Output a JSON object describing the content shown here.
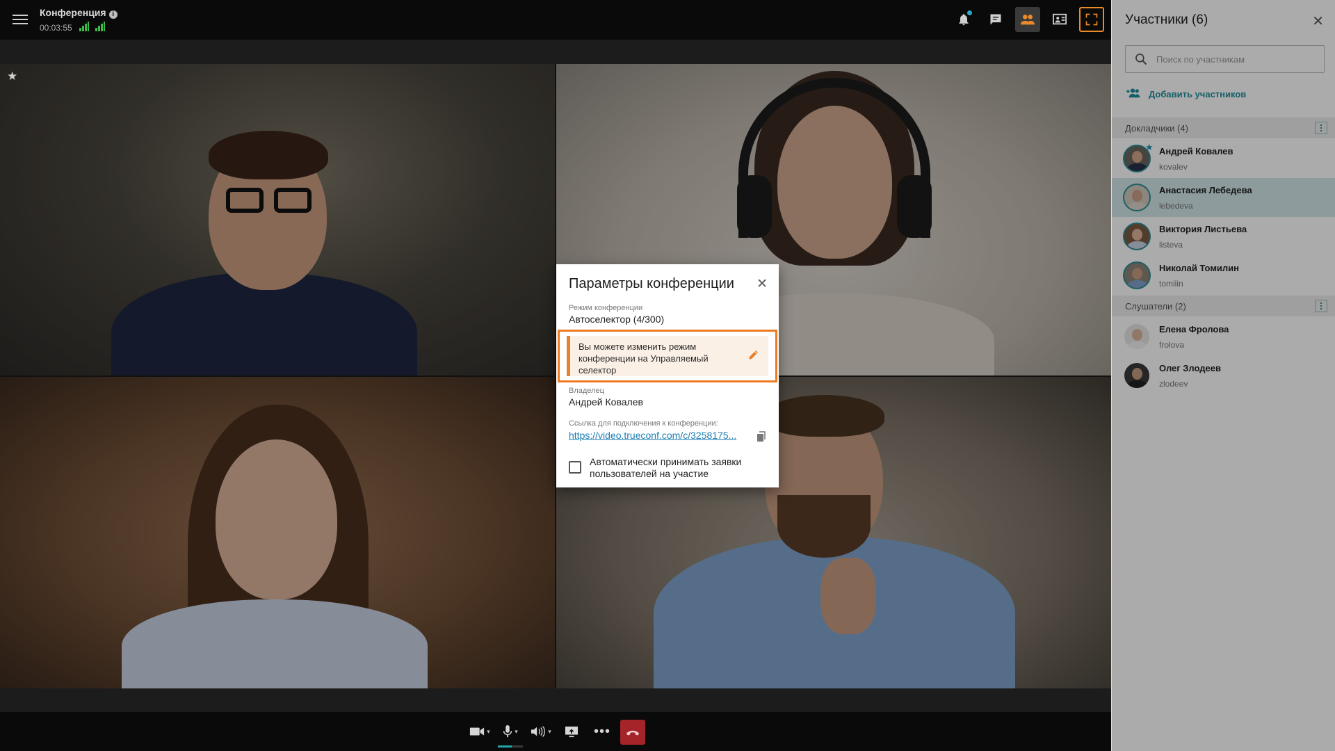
{
  "topbar": {
    "title": "Конференция",
    "timer": "00:03:55",
    "icons": [
      "menu-icon",
      "info-icon",
      "signal-icon",
      "bell-icon",
      "chat-icon",
      "participants-icon",
      "layout-icon",
      "fullscreen-icon"
    ]
  },
  "controls": {
    "icons": [
      "camera-icon",
      "microphone-icon",
      "speaker-icon",
      "screen-share-icon",
      "more-icon",
      "hangup-icon"
    ]
  },
  "panel": {
    "title": "Участники (6)",
    "search_placeholder": "Поиск по участникам",
    "add_label": "Добавить участников",
    "speakers_header": "Докладчики (4)",
    "listeners_header": "Слушатели (2)",
    "speakers": [
      {
        "name": "Андрей Ковалев",
        "login": "kovalev",
        "owner": true,
        "selected": false
      },
      {
        "name": "Анастасия Лебедева",
        "login": "lebedeva",
        "owner": false,
        "selected": true
      },
      {
        "name": "Виктория Листьева",
        "login": "listeva",
        "owner": false,
        "selected": false
      },
      {
        "name": "Николай Томилин",
        "login": "tomilin",
        "owner": false,
        "selected": false
      }
    ],
    "listeners": [
      {
        "name": "Елена Фролова",
        "login": "frolova"
      },
      {
        "name": "Олег Злодеев",
        "login": "zlodeev"
      }
    ]
  },
  "dialog": {
    "title": "Параметры конференции",
    "mode_label": "Режим конференции",
    "mode_value": "Автоселектор (4/300)",
    "hint": "Вы можете изменить режим конференции на Управляемый селектор",
    "owner_label": "Владелец",
    "owner_value": "Андрей Ковалев",
    "link_label": "Ссылка для подключения к конференции:",
    "link_value": "https://video.trueconf.com/c/3258175...",
    "auto_accept_label": "Автоматически принимать заявки пользователей на участие",
    "auto_accept_checked": false
  },
  "colors": {
    "accent_orange": "#ee7a22",
    "accent_teal": "#1d8f9f",
    "hangup_red": "#a4242a",
    "signal_green": "#3db94a"
  }
}
